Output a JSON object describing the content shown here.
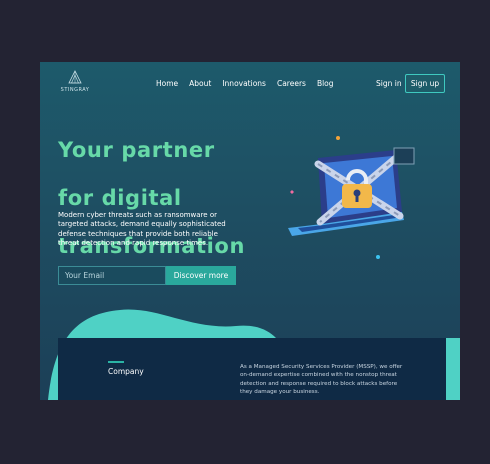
{
  "brand": {
    "name": "STINGRAY"
  },
  "nav": {
    "links": [
      "Home",
      "About",
      "Innovations",
      "Careers",
      "Blog"
    ],
    "signin": "Sign in",
    "signup": "Sign up"
  },
  "hero": {
    "title_lines": [
      "Your partner",
      "for digital",
      "transformation"
    ],
    "description": "Modern cyber threats such as ransomware or targeted attacks, demand equally sophisticated defense techniques that provide both reliable threat detection and rapid response times.",
    "email_placeholder": "Your Email",
    "cta": "Discover more"
  },
  "company": {
    "heading": "Company",
    "text": "As a Managed Security Services Provider (MSSP), we offer on-demand expertise combined with the nonstop threat detection and response required to block attacks before they damage your business."
  },
  "colors": {
    "page_bg": "#232333",
    "accent": "#2aa89c",
    "title_green": "#67d9a8",
    "card_bg": "#0f2a45"
  },
  "icons": [
    "stingray-logo-icon",
    "laptop-lock-illustration"
  ]
}
